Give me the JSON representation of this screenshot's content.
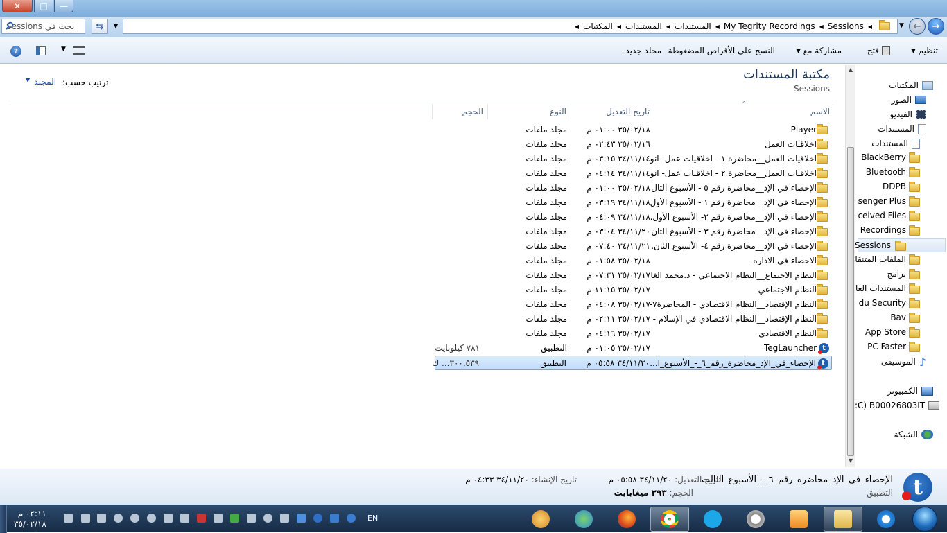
{
  "window": {
    "close": "✕",
    "maximize": "□",
    "minimize": "—"
  },
  "address": {
    "search_placeholder": "بحث في Sessions",
    "crumbs": [
      "المكتبات",
      "المستندات",
      "المستندات",
      "My Tegrity Recordings",
      "Sessions"
    ]
  },
  "toolbar": {
    "organize": "تنظيم",
    "open": "فتح",
    "share_with": "مشاركة مع",
    "burn": "النسخ على الأقراص المضغوطة",
    "new_folder": "مجلد جديد"
  },
  "library": {
    "title": "مكتبة المستندات",
    "subtitle": "Sessions",
    "arrange_label": "ترتيب حسب:",
    "arrange_value": "المجلد"
  },
  "columns": {
    "name": "الاسم",
    "date": "تاريخ التعديل",
    "type": "النوع",
    "size": "الحجم"
  },
  "files": [
    {
      "name": "Player",
      "date": "٣٥/٠٢/١٨ ٠١:٠٠ م",
      "type": "مجلد ملفات",
      "size": "",
      "icon": "folder"
    },
    {
      "name": "اخلاقيات العمل",
      "date": "٣٥/٠٢/١٦ ٠٢:٤٣ م",
      "type": "مجلد ملفات",
      "size": "",
      "icon": "folder"
    },
    {
      "name": "اخلاقيات العمل__محاضرة ١ - اخلاقيات عمل- انور...",
      "date": "٣٤/١١/١٤ ٠٣:١٥ م",
      "type": "مجلد ملفات",
      "size": "",
      "icon": "folder"
    },
    {
      "name": "اخلاقيات العمل__محاضرة ٢ - اخلاقيات عمل- انور...",
      "date": "٣٤/١١/١٤ ٠٤:١٤ م",
      "type": "مجلد ملفات",
      "size": "",
      "icon": "folder"
    },
    {
      "name": "الإحصاء في الإد__محاضرة رقم ٥ - الأسبوع الثال...",
      "date": "٣٥/٠٢/١٨ ٠١:٠٠ م",
      "type": "مجلد ملفات",
      "size": "",
      "icon": "folder"
    },
    {
      "name": "الإحصاء في الإد__محاضرة رقم ١ - الأسبوع الأول...",
      "date": "٣٤/١١/١٨ ٠٣:١٩ م",
      "type": "مجلد ملفات",
      "size": "",
      "icon": "folder"
    },
    {
      "name": "الإحصاء في الإد__محاضرة رقم ٢- الأسبوع الأول...",
      "date": "٣٤/١١/١٨ ٠٤:٠٩ م",
      "type": "مجلد ملفات",
      "size": "",
      "icon": "folder"
    },
    {
      "name": "الإحصاء في الإد__محاضرة رقم ٣ - الأسبوع الثان...",
      "date": "٣٤/١١/٢٠ ٠٣:٠٤ م",
      "type": "مجلد ملفات",
      "size": "",
      "icon": "folder"
    },
    {
      "name": "الإحصاء في الإد__محاضرة رقم ٤- الأسبوع الثان...",
      "date": "٣٤/١١/٢١ ٠٧:٤٠ م",
      "type": "مجلد ملفات",
      "size": "",
      "icon": "folder"
    },
    {
      "name": "الاحصاء في الاداره",
      "date": "٣٥/٠٢/١٨ ٠١:٥٨ م",
      "type": "مجلد ملفات",
      "size": "",
      "icon": "folder"
    },
    {
      "name": "النظام الاجتماع__النظام الاجتماعي - د.محمد الغام...",
      "date": "٣٥/٠٢/١٧ ٠٧:٣١ م",
      "type": "مجلد ملفات",
      "size": "",
      "icon": "folder"
    },
    {
      "name": "النظام الاجتماعي",
      "date": "٣٥/٠٢/١٧ ١١:١٥ م",
      "type": "مجلد ملفات",
      "size": "",
      "icon": "folder"
    },
    {
      "name": "النظام الإقتصاد__النظام الاقتصادي - المحاضرة٧-...",
      "date": "٣٥/٠٢/١٧ ٠٤:٠٨ م",
      "type": "مجلد ملفات",
      "size": "",
      "icon": "folder"
    },
    {
      "name": "النظام الإقتصاد__النظام الاقتصادي في الإسلام - ا...",
      "date": "٣٥/٠٢/١٧ ٠٢:١١ م",
      "type": "مجلد ملفات",
      "size": "",
      "icon": "folder"
    },
    {
      "name": "النظام الاقتصادي",
      "date": "٣٥/٠٢/١٧ ٠٤:١٦ م",
      "type": "مجلد ملفات",
      "size": "",
      "icon": "folder"
    },
    {
      "name": "TegLauncher",
      "date": "٣٥/٠٢/١٧ ٠١:٠٥ م",
      "type": "التطبيق",
      "size": "٧٨١ كيلوبايت",
      "icon": "app"
    },
    {
      "name": "الإحصاء_في_الإد_محاضرة_رقم_٦_-_الأسبوع_ا...",
      "date": "٣٤/١١/٢٠ ٠٥:٥٨ م",
      "type": "التطبيق",
      "size": "٣٠٠,٥٣٩... ك",
      "icon": "app",
      "selected": true
    }
  ],
  "nav": {
    "libraries": "المكتبات",
    "pictures": "الصور",
    "videos": "الفيديو",
    "documents": "المستندات",
    "documents2": "المستندات",
    "folders": [
      "BlackBerry",
      "Bluetooth",
      "DDPB",
      "senger Plus",
      "ceived Files",
      "Recordings",
      "Sessions",
      "الملفات المتنقا",
      "برامج",
      "المستندات العامة",
      "du Security",
      "Bav",
      "App Store",
      "PC Faster"
    ],
    "music": "الموسيقى",
    "computer": "الكمبيوتر",
    "drive": "TI30862000B (C:",
    "network": "الشبكة"
  },
  "details": {
    "name": "الإحصاء_في_الإد_محاضرة_رقم_٦_-_الأسبوع_الثالث...",
    "type": "التطبيق",
    "modified_label": "تاريخ التعديل:",
    "modified": "٣٤/١١/٢٠ ٠٥:٥٨ م",
    "size_label": "الحجم:",
    "size": "٢٩٣ ميغابايت",
    "created_label": "تاريخ الإنشاء:",
    "created": "٣٤/١١/٢٠ ٠٤:٣٣ م"
  },
  "taskbar": {
    "time": "٠٢:١١ م",
    "date": "٣٥/٠٢/١٨",
    "lang": "EN"
  }
}
